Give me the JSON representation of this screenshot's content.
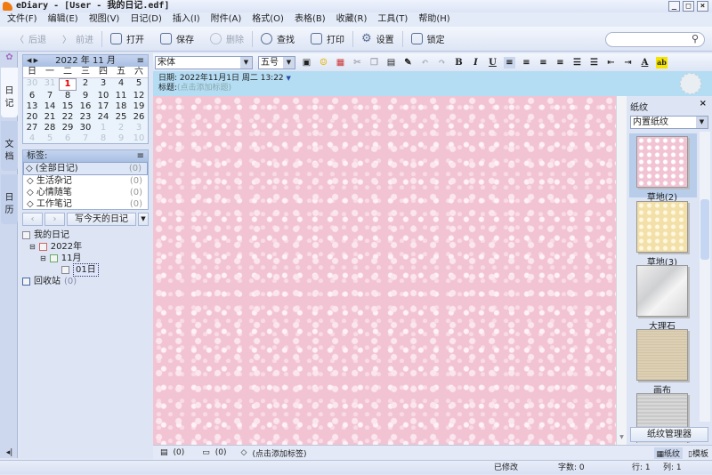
{
  "window": {
    "title": "eDiary - [User - 我的日记.edf]"
  },
  "menu": [
    "文件(F)",
    "编辑(E)",
    "视图(V)",
    "日记(D)",
    "插入(I)",
    "附件(A)",
    "格式(O)",
    "表格(B)",
    "收藏(R)",
    "工具(T)",
    "帮助(H)"
  ],
  "toolbar": {
    "back": "后退",
    "forward": "前进",
    "open": "打开",
    "save": "保存",
    "delete": "删除",
    "find": "查找",
    "print": "打印",
    "settings": "设置",
    "lock": "锁定"
  },
  "vtabs": [
    "日记",
    "文档",
    "日历"
  ],
  "calendar": {
    "year": "2022",
    "year_label": "年",
    "month": "11",
    "month_label": "月",
    "weekdays": [
      "日",
      "一",
      "二",
      "三",
      "四",
      "五",
      "六"
    ],
    "weeks": [
      [
        "30",
        "31",
        "1",
        "2",
        "3",
        "4",
        "5"
      ],
      [
        "6",
        "7",
        "8",
        "9",
        "10",
        "11",
        "12"
      ],
      [
        "13",
        "14",
        "15",
        "16",
        "17",
        "18",
        "19"
      ],
      [
        "20",
        "21",
        "22",
        "23",
        "24",
        "25",
        "26"
      ],
      [
        "27",
        "28",
        "29",
        "30",
        "1",
        "2",
        "3"
      ],
      [
        "4",
        "5",
        "6",
        "7",
        "8",
        "9",
        "10"
      ]
    ],
    "selected": "1"
  },
  "tags": {
    "title": "标签:",
    "items": [
      {
        "label": "(全部日记)",
        "count": "(0)"
      },
      {
        "label": "生活杂记",
        "count": "(0)"
      },
      {
        "label": "心情随笔",
        "count": "(0)"
      },
      {
        "label": "工作笔记",
        "count": "(0)"
      }
    ]
  },
  "write_today": "写今天的日记",
  "tree": {
    "root": "我的日记",
    "year": "2022年",
    "month": "11月",
    "day": "01日",
    "trash": "回收站",
    "trash_count": "(0)"
  },
  "editor": {
    "font": "宋体",
    "size": "五号",
    "date_label": "日期:",
    "date": "2022年11月1日 周二 13:22",
    "title_label": "标题:",
    "title_placeholder": "(点击添加标题)"
  },
  "paper_panel": {
    "title": "纸纹",
    "select": "内置纸纹",
    "items": [
      "草地(2)",
      "草地(3)",
      "大理石",
      "画布"
    ],
    "manager": "纸纹管理器"
  },
  "bottom": {
    "attach_count": "(0)",
    "comment_count": "(0)",
    "tag_placeholder": "(点击添加标签)",
    "paper_tab": "纸纹",
    "template_tab": "模板"
  },
  "status": {
    "modified": "已修改",
    "words": "字数: 0",
    "row": "行: 1",
    "col": "列: 1"
  }
}
